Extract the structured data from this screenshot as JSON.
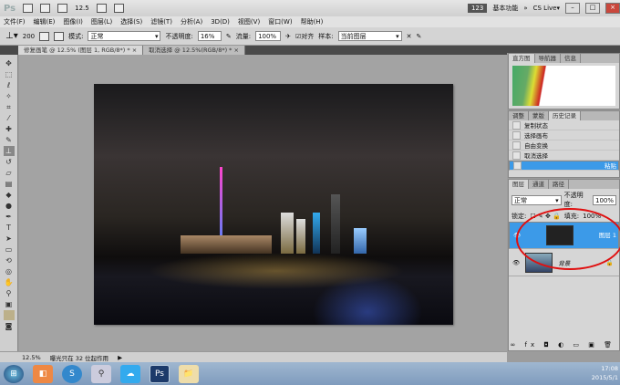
{
  "titlebar": {
    "logo": "Ps",
    "zoom": "12.5",
    "workspace_badge": "123",
    "workspace": "基本功能",
    "more": "»",
    "cslive": "CS Live▾"
  },
  "menu": [
    "文件(F)",
    "编辑(E)",
    "图像(I)",
    "图层(L)",
    "选择(S)",
    "滤镜(T)",
    "分析(A)",
    "3D(D)",
    "视图(V)",
    "窗口(W)",
    "帮助(H)"
  ],
  "options": {
    "brush_size": "200",
    "mode_label": "模式:",
    "mode": "正常",
    "opacity_label": "不透明度:",
    "opacity": "16%",
    "flow_label": "流量:",
    "flow": "100%",
    "aligned": "对齐",
    "sample_label": "样本:",
    "sample": "当前图层"
  },
  "tabs": [
    {
      "label": "修复画笔 @ 12.5% (图层 1, RGB/8*) * ×"
    },
    {
      "label": "取消选择 @ 12.5%(RGB/8*) * ×"
    }
  ],
  "status": {
    "zoom": "12.5%",
    "info": "曝光只在 32 位起作用"
  },
  "histogram_panel": {
    "tabs": [
      "直方图",
      "导航器",
      "信息"
    ]
  },
  "history_panel": {
    "tabs": [
      "调整",
      "蒙版",
      "历史记录"
    ],
    "items": [
      "复制状态",
      "选择画布",
      "自由变换",
      "取消选择",
      "粘贴"
    ],
    "selected": 4
  },
  "layers_panel": {
    "tabs": [
      "图层",
      "通道",
      "路径"
    ],
    "blend": "正常",
    "opacity_label": "不透明度:",
    "opacity": "100%",
    "lock_label": "锁定:",
    "fill_label": "填充:",
    "fill": "100%",
    "layers": [
      {
        "name": "图层 1",
        "selected": true
      },
      {
        "name": "背景",
        "locked": true
      }
    ]
  },
  "taskbar": {
    "time": "17:08",
    "date": "2015/5/1"
  },
  "colors": {
    "selection": "#3c9ae8",
    "annotation": "#e01010"
  }
}
